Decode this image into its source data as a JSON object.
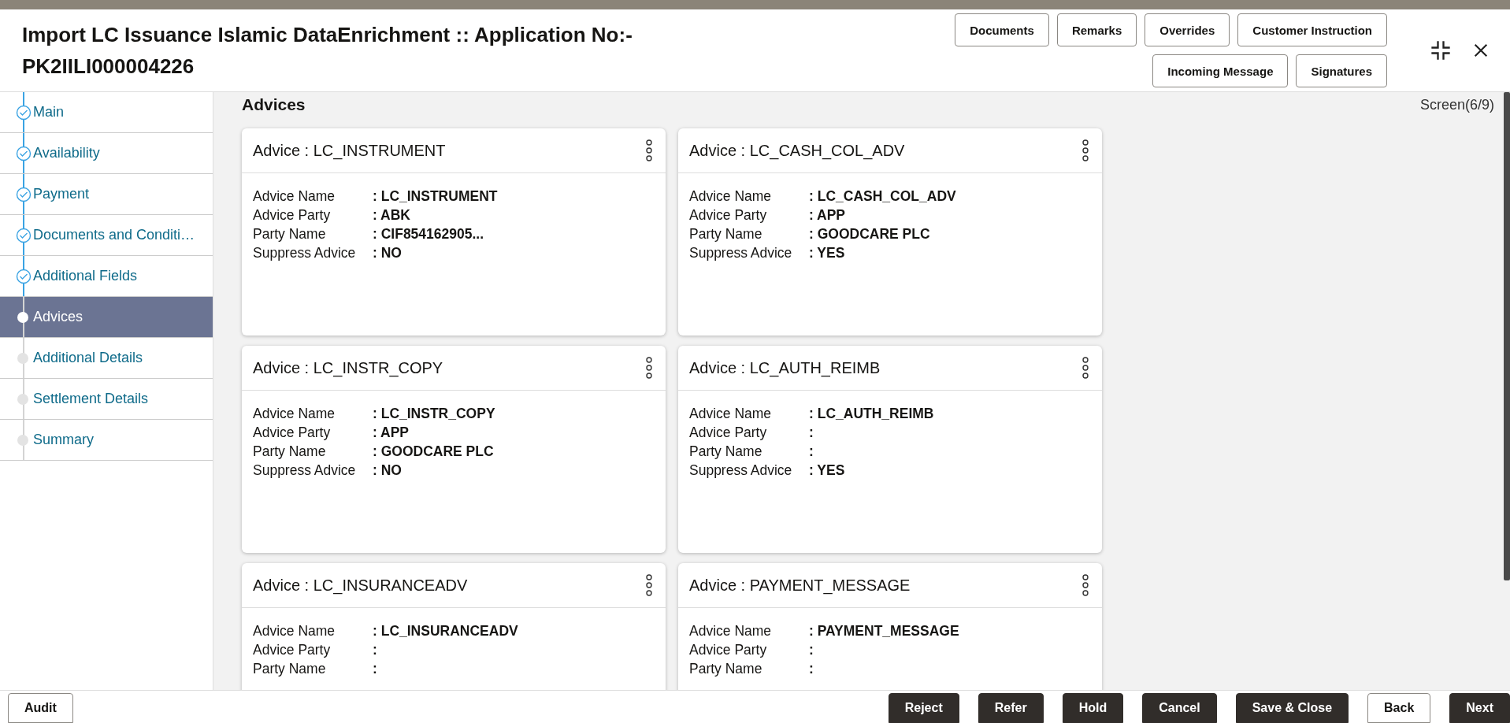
{
  "header": {
    "title": "Import LC Issuance Islamic DataEnrichment :: Application No:- PK2IILI000004226",
    "button_rows": [
      [
        "Documents",
        "Remarks",
        "Overrides",
        "Customer Instruction"
      ],
      [
        "Incoming Message",
        "Signatures"
      ]
    ]
  },
  "sidebar": {
    "items": [
      {
        "label": "Main",
        "completed": true,
        "selected": false
      },
      {
        "label": "Availability",
        "completed": true,
        "selected": false
      },
      {
        "label": "Payment",
        "completed": true,
        "selected": false
      },
      {
        "label": "Documents and Conditi…",
        "completed": true,
        "selected": false
      },
      {
        "label": "Additional Fields",
        "completed": true,
        "selected": false
      },
      {
        "label": "Advices",
        "completed": false,
        "selected": true
      },
      {
        "label": "Additional Details",
        "completed": false,
        "selected": false
      },
      {
        "label": "Settlement Details",
        "completed": false,
        "selected": false
      },
      {
        "label": "Summary",
        "completed": false,
        "selected": false
      }
    ]
  },
  "section": {
    "title": "Advices",
    "screen_counter": "Screen(6/9)"
  },
  "cards": [
    {
      "title": "Advice : LC_INSTRUMENT",
      "fields": [
        {
          "label": "Advice Name",
          "value": ": LC_INSTRUMENT"
        },
        {
          "label": "Advice Party",
          "value": ": ABK"
        },
        {
          "label": "Party Name",
          "value": ": CIF854162905..."
        },
        {
          "label": "Suppress Advice",
          "value": ": NO"
        }
      ]
    },
    {
      "title": "Advice : LC_CASH_COL_ADV",
      "fields": [
        {
          "label": "Advice Name",
          "value": ": LC_CASH_COL_ADV"
        },
        {
          "label": "Advice Party",
          "value": ": APP"
        },
        {
          "label": "Party Name",
          "value": ": GOODCARE PLC"
        },
        {
          "label": "Suppress Advice",
          "value": ": YES"
        }
      ]
    },
    {
      "title": "Advice : LC_INSTR_COPY",
      "fields": [
        {
          "label": "Advice Name",
          "value": ": LC_INSTR_COPY"
        },
        {
          "label": "Advice Party",
          "value": ": APP"
        },
        {
          "label": "Party Name",
          "value": ": GOODCARE PLC"
        },
        {
          "label": "Suppress Advice",
          "value": ": NO"
        }
      ]
    },
    {
      "title": "Advice : LC_AUTH_REIMB",
      "fields": [
        {
          "label": "Advice Name",
          "value": ": LC_AUTH_REIMB"
        },
        {
          "label": "Advice Party",
          "value": ":"
        },
        {
          "label": "Party Name",
          "value": ":"
        },
        {
          "label": "Suppress Advice",
          "value": ": YES"
        }
      ]
    },
    {
      "title": "Advice : LC_INSURANCEADV",
      "fields": [
        {
          "label": "Advice Name",
          "value": ": LC_INSURANCEADV"
        },
        {
          "label": "Advice Party",
          "value": ":"
        },
        {
          "label": "Party Name",
          "value": ":"
        }
      ]
    },
    {
      "title": "Advice : PAYMENT_MESSAGE",
      "fields": [
        {
          "label": "Advice Name",
          "value": ": PAYMENT_MESSAGE"
        },
        {
          "label": "Advice Party",
          "value": ":"
        },
        {
          "label": "Party Name",
          "value": ":"
        }
      ]
    }
  ],
  "footer": {
    "left_buttons": [
      {
        "label": "Audit",
        "kind": "secondary"
      }
    ],
    "right_buttons": [
      {
        "label": "Reject",
        "kind": "primary"
      },
      {
        "label": "Refer",
        "kind": "primary"
      },
      {
        "label": "Hold",
        "kind": "primary"
      },
      {
        "label": "Cancel",
        "kind": "primary"
      },
      {
        "label": "Save & Close",
        "kind": "primary"
      },
      {
        "label": "Back",
        "kind": "secondary"
      },
      {
        "label": "Next",
        "kind": "primary"
      }
    ]
  }
}
